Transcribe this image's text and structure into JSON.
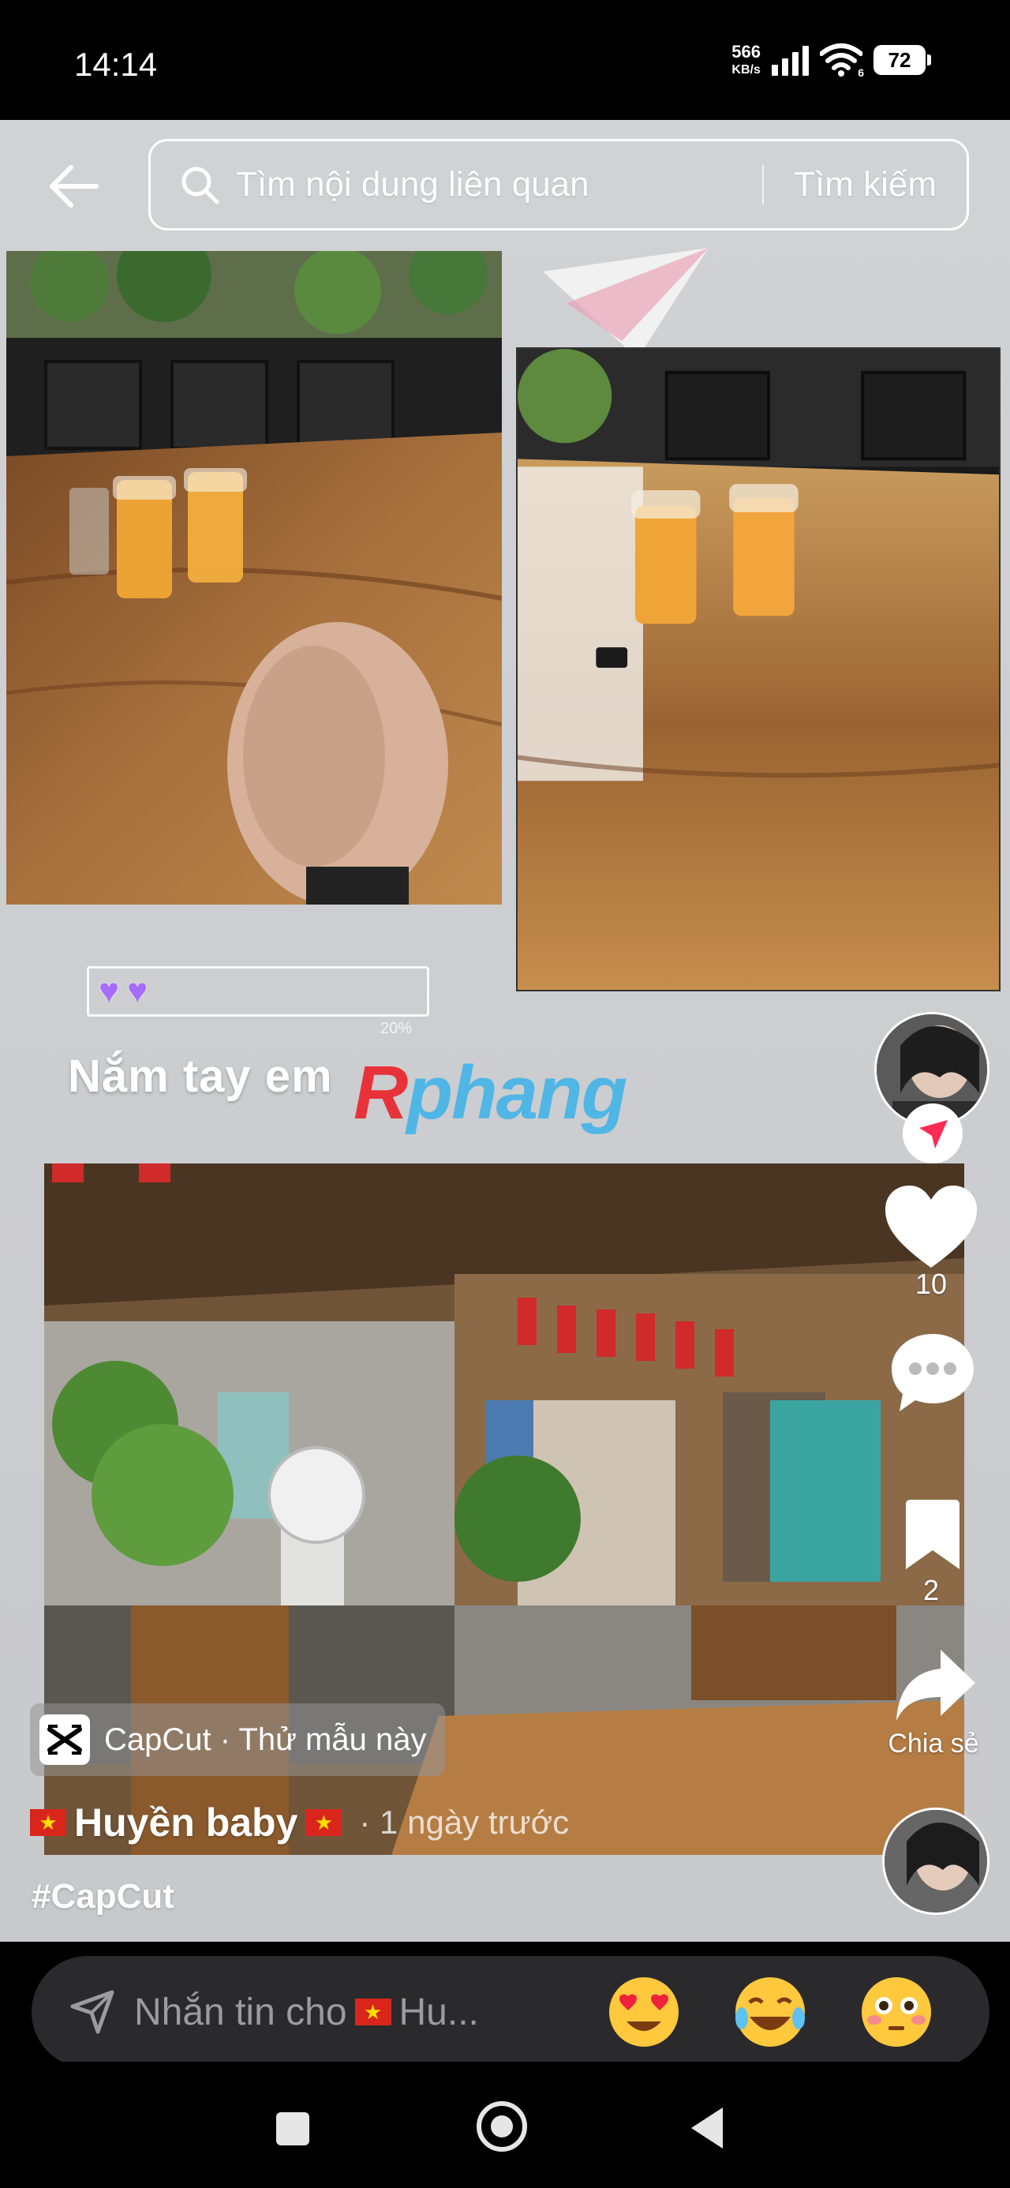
{
  "status_bar": {
    "time": "14:14",
    "net_speed_value": "566",
    "net_speed_unit": "KB/s",
    "wifi_badge": "6",
    "battery": "72"
  },
  "search": {
    "placeholder": "Tìm nội dung liên quan",
    "submit_label": "Tìm kiếm",
    "back_icon": "arrow-left-icon"
  },
  "video": {
    "overlay_caption": "Nắm tay em",
    "watermark_first": "R",
    "watermark_rest": "phang",
    "sticker_percent": "20%",
    "sticker_hearts": [
      "♥",
      "♥"
    ]
  },
  "actions": {
    "like_count": "10",
    "save_count": "2",
    "share_label": "Chia sẻ",
    "icons": [
      "heart-icon",
      "comment-icon",
      "bookmark-icon",
      "share-icon"
    ]
  },
  "post": {
    "template_label": "CapCut · Thử mẫu này",
    "author_name": "Huyền baby",
    "time_ago": "· 1 ngày trước",
    "hashtag": "#CapCut"
  },
  "message": {
    "placeholder_prefix": "Nhắn tin cho",
    "placeholder_suffix": "Hu...",
    "emojis": [
      "😍",
      "😂",
      "😳"
    ]
  },
  "colors": {
    "background": "#cccdd0",
    "accent_red": "#fe2c55",
    "watermark_red": "#e8323a",
    "watermark_blue": "#4fb6e6"
  }
}
